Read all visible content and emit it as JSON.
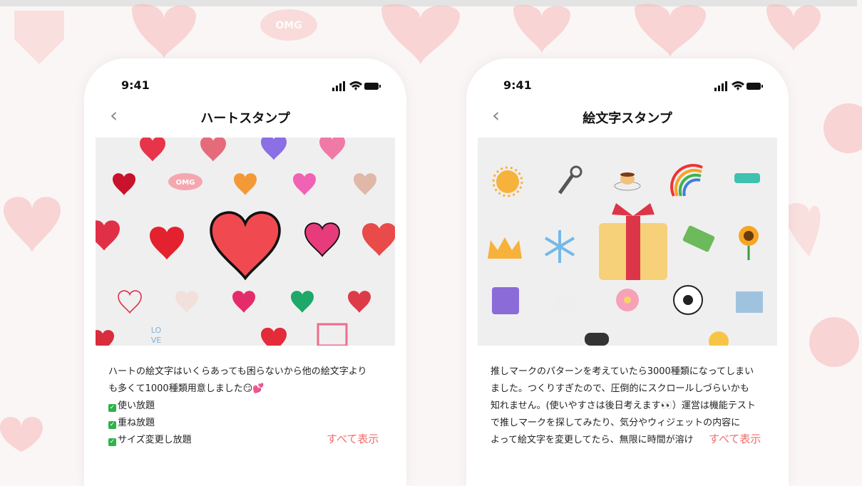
{
  "colors": {
    "accent": "#ef6d6d",
    "background": "#fbf6f6",
    "stamp_bg": "#f0eff0"
  },
  "left_phone": {
    "time": "9:41",
    "title": "ハートスタンプ",
    "description_lines": [
      "ハートの絵文字はいくらあっても困らないから他の絵文字より",
      "も多くて1000種類用意しました😏💕"
    ],
    "features": [
      "使い放題",
      "重ね放題",
      "サイズ変更し放題"
    ],
    "show_all": "すべて表示",
    "stamp_text": [
      "OMG",
      "LO",
      "VE"
    ]
  },
  "right_phone": {
    "time": "9:41",
    "title": "絵文字スタンプ",
    "description_lines": [
      "推しマークのパターンを考えていたら3000種類になってしまい",
      "ました。つくりすぎたので、圧倒的にスクロールしづらいかも",
      "知れません。(使いやすさは後日考えます👀）運営は機能テスト",
      "で推しマークを探してみたり、気分やウィジェットの内容に",
      "よって絵文字を変更してたら、無限に時間が溶け"
    ],
    "show_all": "すべて表示"
  },
  "background_decoration": {
    "omg_text": "OMG"
  },
  "icons": [
    "back-chevron-icon",
    "signal-icon",
    "wifi-icon",
    "battery-icon",
    "check-icon"
  ]
}
